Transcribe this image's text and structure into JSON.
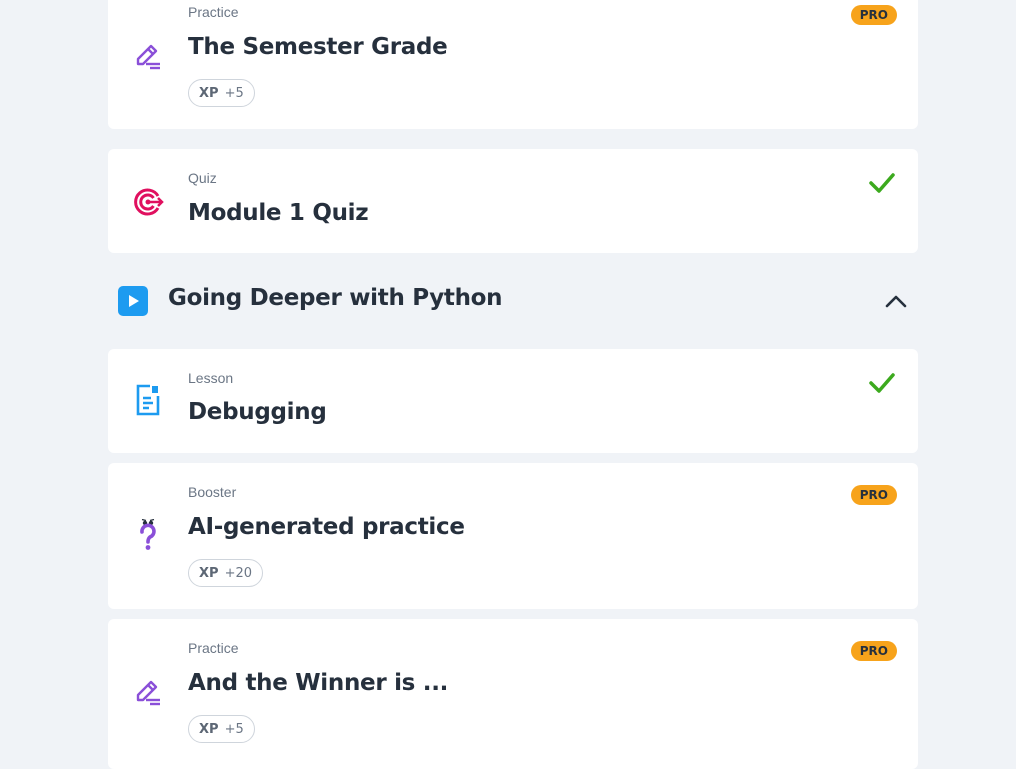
{
  "items": [
    {
      "type": "Practice",
      "title": "The Semester Grade",
      "xp_label": "XP",
      "xp_value": "+5",
      "badge": "PRO",
      "icon": "pencil-icon"
    },
    {
      "type": "Quiz",
      "title": "Module 1 Quiz",
      "status": "completed",
      "icon": "target-icon"
    },
    {
      "type": "Lesson",
      "title": "Debugging",
      "status": "completed",
      "icon": "document-icon"
    },
    {
      "type": "Booster",
      "title": "AI-generated practice",
      "xp_label": "XP",
      "xp_value": "+20",
      "badge": "PRO",
      "icon": "question-icon"
    },
    {
      "type": "Practice",
      "title": "And the Winner is ...",
      "xp_label": "XP",
      "xp_value": "+5",
      "badge": "PRO",
      "icon": "pencil-icon"
    }
  ],
  "module": {
    "title": "Going Deeper with Python",
    "icon": "play-icon",
    "expanded": true
  },
  "colors": {
    "background": "#f0f3f7",
    "card": "#ffffff",
    "pro_badge": "#f7a31b",
    "check": "#3caa1e",
    "practice_icon": "#8a4fd8",
    "quiz_icon": "#e0105f",
    "lesson_icon": "#1d9bf0",
    "module_play": "#1d9bf0"
  }
}
